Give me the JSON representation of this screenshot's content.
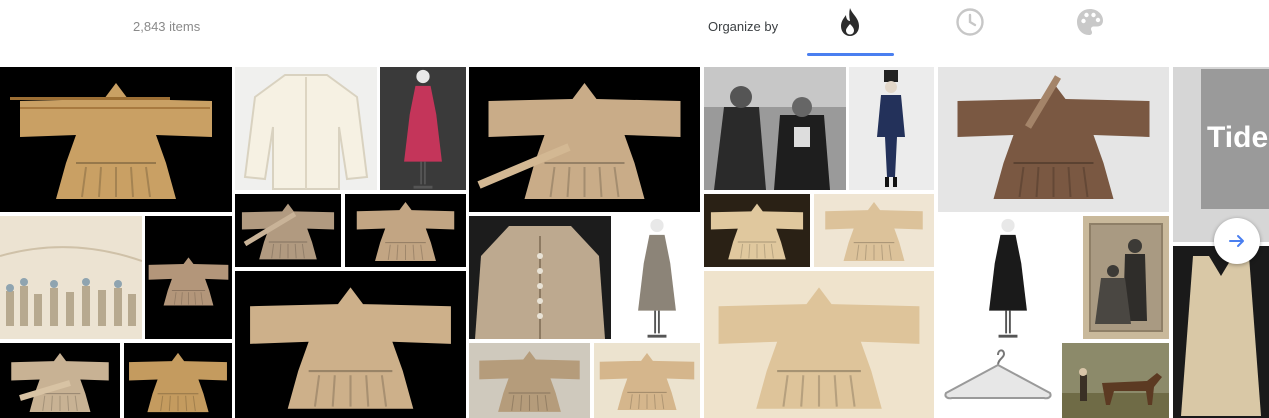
{
  "header": {
    "item_count": "2,843 items",
    "organize_label": "Organize by",
    "organize_options": [
      {
        "icon": "flame-icon",
        "active": true
      },
      {
        "icon": "clock-icon",
        "active": false
      },
      {
        "icon": "palette-icon",
        "active": false
      }
    ]
  },
  "colors": {
    "accent": "#4a7ff0",
    "tile_black": "#000000",
    "paper_tan": "#cdb08a",
    "robe_brown": "#7a5842"
  },
  "gallery": {
    "tile_count": 32,
    "tide_box_text": "Tide"
  },
  "navigation": {
    "next_icon": "arrow-right-icon"
  }
}
